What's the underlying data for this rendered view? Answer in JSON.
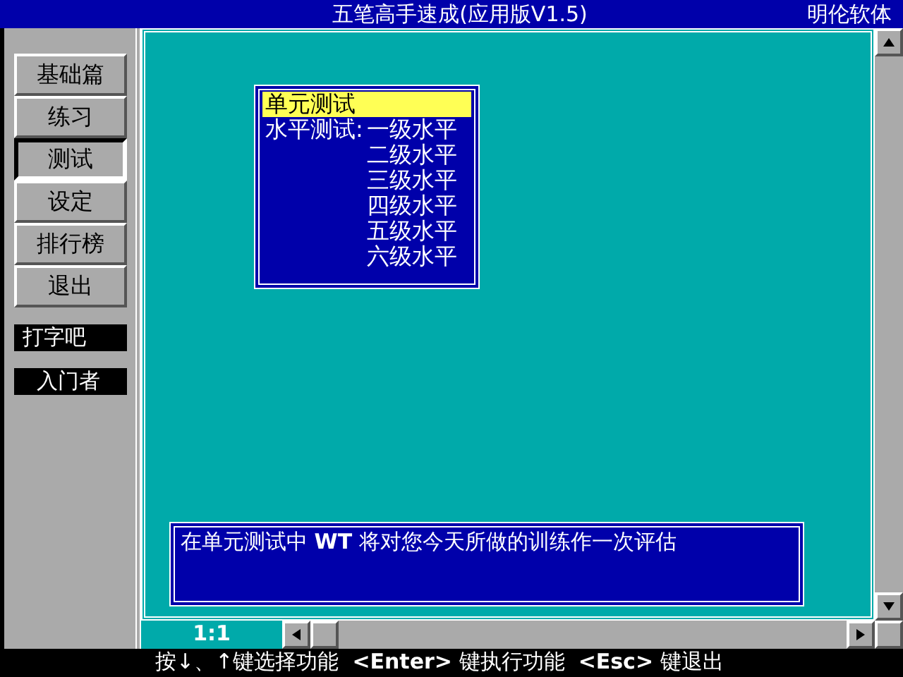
{
  "window": {
    "title": "五笔高手速成(应用版V1.5)",
    "vendor": "明伦软体"
  },
  "sidebar": {
    "items": [
      {
        "label": "基础篇",
        "selected": false
      },
      {
        "label": "练习",
        "selected": false
      },
      {
        "label": "测试",
        "selected": true
      },
      {
        "label": "设定",
        "selected": false
      },
      {
        "label": "排行榜",
        "selected": false
      },
      {
        "label": "退出",
        "selected": false
      }
    ],
    "labels": [
      "打字吧",
      "入门者"
    ]
  },
  "menu": {
    "items": [
      {
        "label": "单元测试",
        "selected": true
      },
      {
        "prefix": "水平测试:",
        "label": "一级水平",
        "selected": false
      },
      {
        "label": "二级水平",
        "selected": false
      },
      {
        "label": "三级水平",
        "selected": false
      },
      {
        "label": "四级水平",
        "selected": false
      },
      {
        "label": "五级水平",
        "selected": false
      },
      {
        "label": "六级水平",
        "selected": false
      }
    ]
  },
  "message": "在单元测试中 **WT** 将对您今天所做的训练作一次评估",
  "status_bar": {
    "position": "1:1",
    "help": "按↓、↑键选择功能  **<Enter>** 键执行功能  **<Esc>** 键退出"
  }
}
